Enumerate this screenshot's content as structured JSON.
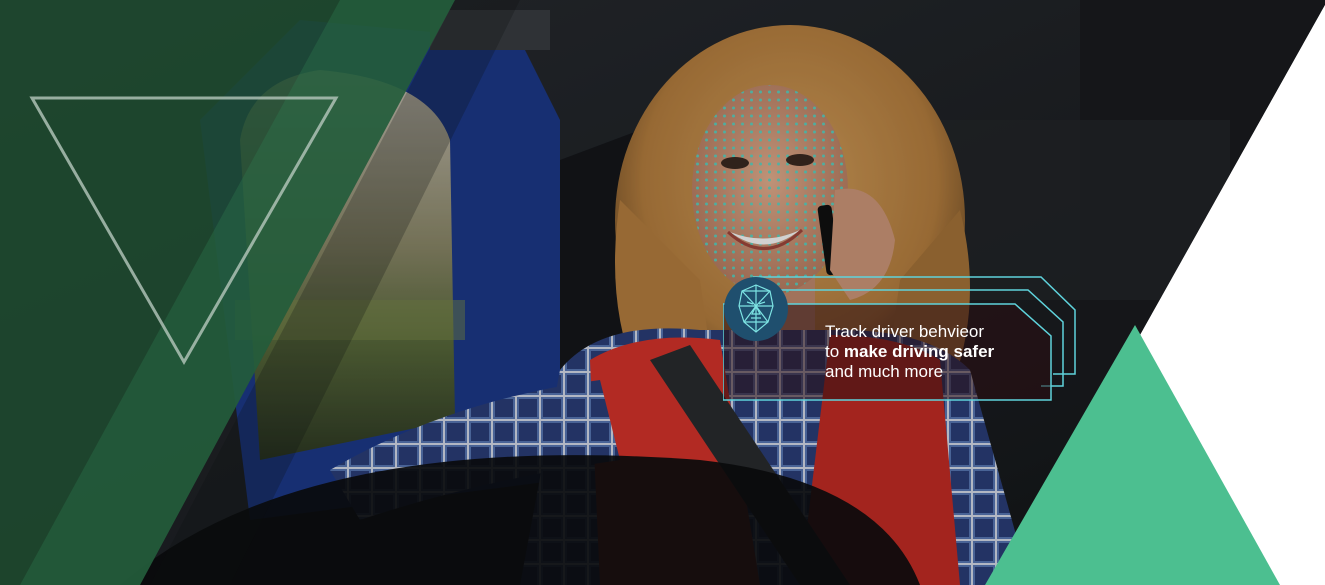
{
  "banner": {
    "image": "woman-driver-on-phone-with-face-tracking-dots",
    "callout": {
      "icon": "face-scan-icon",
      "line1": "Track driver behvieor",
      "line2_prefix": "to ",
      "line2_bold": "make driving safer",
      "line3": "and much more"
    },
    "colors": {
      "accent_green": "#4cbf90",
      "dark_green": "#1f4a2e",
      "outline_cyan": "#5fd3dc",
      "dot_cyan": "#4fe0d0",
      "vest_red": "#d9342b"
    }
  }
}
